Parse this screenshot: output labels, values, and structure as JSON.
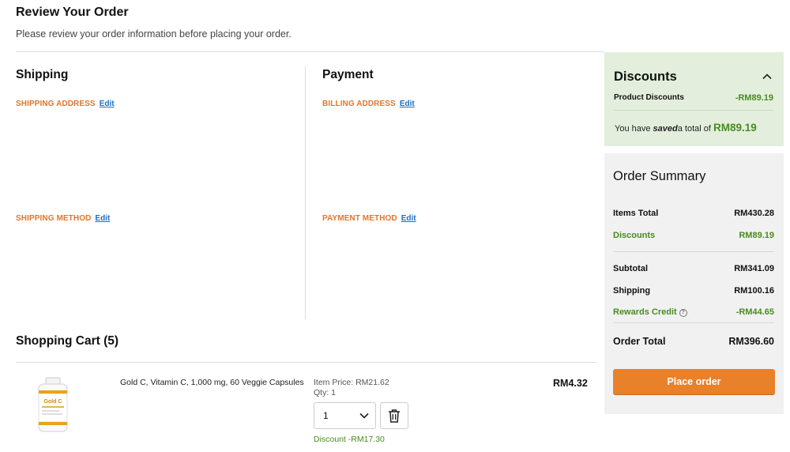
{
  "header": {
    "title": "Review Your Order",
    "subtitle": "Please review your order information before placing your order."
  },
  "shipping": {
    "title": "Shipping",
    "address_label": "SHIPPING ADDRESS",
    "method_label": "SHIPPING METHOD",
    "edit_label": "Edit"
  },
  "payment": {
    "title": "Payment",
    "address_label": "BILLING ADDRESS",
    "method_label": "PAYMENT METHOD",
    "edit_label": "Edit"
  },
  "cart": {
    "title": "Shopping Cart (5)",
    "items": [
      {
        "name": "Gold C, Vitamin C, 1,000 mg, 60 Veggie Capsules",
        "item_price": "Item Price: RM21.62",
        "qty": "Qty: 1",
        "qty_select": "1",
        "discount": "Discount -RM17.30",
        "total": "RM4.32",
        "image_label": "Gold C"
      }
    ]
  },
  "discounts": {
    "title": "Discounts",
    "product_discounts_label": "Product Discounts",
    "product_discounts_value": "-RM89.19",
    "saved_prefix": "You have",
    "saved_word": "saved",
    "saved_middle": "a total of",
    "saved_amount": "RM89.19"
  },
  "summary": {
    "title": "Order Summary",
    "items_total_label": "Items Total",
    "items_total_value": "RM430.28",
    "discounts_label": "Discounts",
    "discounts_value": "RM89.19",
    "subtotal_label": "Subtotal",
    "subtotal_value": "RM341.09",
    "shipping_label": "Shipping",
    "shipping_value": "RM100.16",
    "rewards_label": "Rewards Credit",
    "rewards_value": "-RM44.65",
    "order_total_label": "Order Total",
    "order_total_value": "RM396.60",
    "place_order_label": "Place order"
  },
  "colors": {
    "accent_orange": "#e8812a",
    "label_orange": "#e0762a",
    "green": "#4a8a21",
    "link_blue": "#1a6fc7",
    "discount_panel_bg": "#e3efdc",
    "summary_panel_bg": "#f1f1f1"
  }
}
